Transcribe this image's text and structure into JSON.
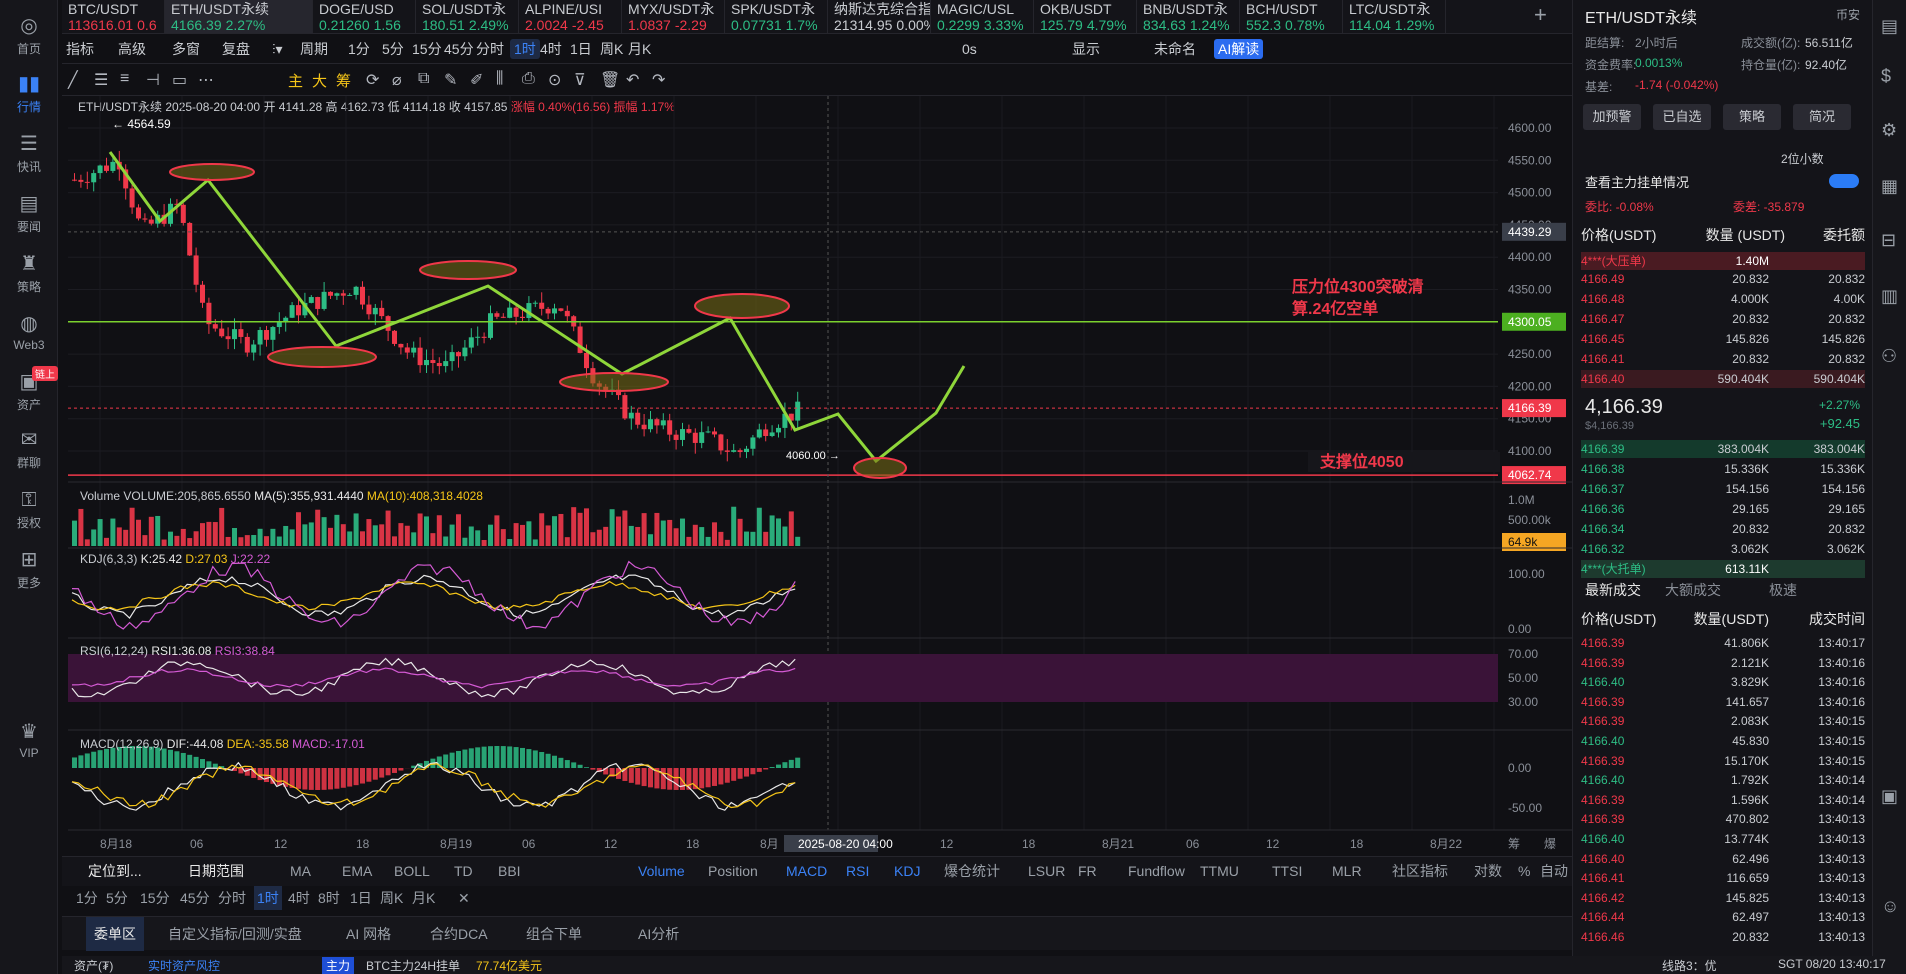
{
  "nav": [
    {
      "label": "首页",
      "icon": "◎"
    },
    {
      "label": "行情",
      "icon": "▮▮"
    },
    {
      "label": "快讯",
      "icon": "☰"
    },
    {
      "label": "要闻",
      "icon": "▤"
    },
    {
      "label": "策略",
      "icon": "♜"
    },
    {
      "label": "Web3",
      "icon": "◍"
    },
    {
      "label": "资产",
      "icon": "▣",
      "badge": "链上"
    },
    {
      "label": "群聊",
      "icon": "✉"
    },
    {
      "label": "授权",
      "icon": "⚿"
    },
    {
      "label": "更多",
      "icon": "⊞"
    },
    {
      "label": "VIP",
      "icon": "♛"
    }
  ],
  "tickers": [
    {
      "name": "BTC/USDT",
      "price": "113616.01",
      "change": "0.6",
      "dir": "down"
    },
    {
      "name": "ETH/USDT永续",
      "price": "4166.39",
      "change": "2.27%",
      "dir": "up",
      "selected": true
    },
    {
      "name": "DOGE/USD",
      "price": "0.21260",
      "change": "1.56",
      "dir": "up"
    },
    {
      "name": "SOL/USDT永",
      "price": "180.51",
      "change": "2.49%",
      "dir": "up"
    },
    {
      "name": "ALPINE/USI",
      "price": "2.0024",
      "change": "-2.45",
      "dir": "down"
    },
    {
      "name": "MYX/USDT永",
      "price": "1.0837",
      "change": "-2.29",
      "dir": "down"
    },
    {
      "name": "SPK/USDT永",
      "price": "0.07731",
      "change": "1.7%",
      "dir": "up"
    },
    {
      "name": "纳斯达克综合指数",
      "price": "21314.95",
      "change": "0.00%",
      "dir": "flat"
    },
    {
      "name": "MAGIC/USL",
      "price": "0.2299",
      "change": "3.33%",
      "dir": "up"
    },
    {
      "name": "OKB/USDT",
      "price": "125.79",
      "change": "4.79%",
      "dir": "up"
    },
    {
      "name": "BNB/USDT永",
      "price": "834.63",
      "change": "1.24%",
      "dir": "up"
    },
    {
      "name": "BCH/USDT",
      "price": "552.3",
      "change": "0.78%",
      "dir": "up"
    },
    {
      "name": "LTC/USDT永",
      "price": "114.04",
      "change": "1.29%",
      "dir": "up"
    }
  ],
  "toolbar": {
    "items": [
      "指标",
      "高级",
      "多窗",
      "复盘",
      "",
      "周期",
      "1分",
      "5分",
      "15分",
      "45分",
      "分时",
      "1时",
      "4时",
      "1日",
      "周K",
      "月K"
    ],
    "active": "1时",
    "right": [
      "0s",
      "显示",
      "未命名",
      "AI解读"
    ]
  },
  "drawtools": {
    "labels": [
      "主",
      "大",
      "筹"
    ]
  },
  "ohlc": {
    "symbol": "ETH/USDT永续",
    "time": "2025-08-20 04:00",
    "open": "开 4141.28",
    "high": "高 4162.73",
    "low": "低 4114.18",
    "close": "收 4157.85",
    "chg": "涨幅 0.40%(16.56)",
    "amp": "振幅 1.17%"
  },
  "price_axis": [
    "4600.00",
    "4550.00",
    "4500.00",
    "4450.00",
    "4400.00",
    "4350.00",
    "4300.00",
    "4250.00",
    "4200.00",
    "4150.00",
    "4100.00"
  ],
  "price_tags": {
    "crosshair": "4439.29",
    "resistance": "4300.05",
    "current": "4166.39",
    "support": "4062.74",
    "vol_tag": "64.9k"
  },
  "annotations": {
    "high": "← 4564.59",
    "low": "4060.00 →",
    "resistance_text1": "压力位4300突破清",
    "resistance_text2": "算.24亿空单",
    "support_text": "支撑位4050"
  },
  "volume": {
    "title": "Volume",
    "vol": "VOLUME:205,865.6550",
    "ma5": "MA(5):355,931.4440",
    "ma10": "MA(10):408,318.4028",
    "axis": [
      "1.0M",
      "500.00k"
    ]
  },
  "kdj": {
    "title": "KDJ(6,3,3)",
    "k": "K:25.42",
    "d": "D:27.03",
    "j": "J:22.22",
    "axis": [
      "100.00",
      "0.00"
    ]
  },
  "rsi": {
    "title": "RSI(6,12,24)",
    "rsi1": "RSI1:36.08",
    "rsi3": "RSI3:38.84",
    "axis": [
      "70.00",
      "50.00",
      "30.00"
    ]
  },
  "macd": {
    "title": "MACD(12,26,9)",
    "dif": "DIF:-44.08",
    "dea": "DEA:-35.58",
    "macd": "MACD:-17.01",
    "axis": [
      "0.00",
      "-50.00"
    ]
  },
  "xaxis": [
    "8月18",
    "06",
    "12",
    "18",
    "8月19",
    "06",
    "12",
    "18",
    "8月",
    "2025-08-20 04:00",
    "12",
    "18",
    "8月21",
    "06",
    "12",
    "18",
    "8月22",
    "筹",
    "爆"
  ],
  "bottom1": {
    "left": [
      "定位到...",
      "日期范围"
    ],
    "items": [
      "MA",
      "EMA",
      "BOLL",
      "TD",
      "BBI",
      "Volume",
      "Position",
      "MACD",
      "RSI",
      "KDJ",
      "爆仓统计",
      "LSUR",
      "FR",
      "Fundflow",
      "TTMU",
      "TTSI",
      "MLR",
      "社区指标",
      "对数",
      "%",
      "自动"
    ],
    "active": [
      "Volume",
      "MACD",
      "RSI",
      "KDJ"
    ]
  },
  "bottom2": {
    "items": [
      "1分",
      "5分",
      "15分",
      "45分",
      "分时",
      "1时",
      "4时",
      "8时",
      "1日",
      "周K",
      "月K",
      "✕"
    ],
    "active": "1时"
  },
  "bottom3": {
    "items": [
      "委单区",
      "自定义指标/回测/实盘",
      "AI 网格",
      "合约DCA",
      "组合下单",
      "AI分析"
    ],
    "active": "委单区"
  },
  "statusbar": {
    "assets": "资产(₮)",
    "risk": "实时资产风控",
    "main": "主力",
    "news": "BTC主力24H挂单",
    "amount": "77.74亿美元",
    "line": "线路3：优",
    "time": "SGT 08/20 13:40:17"
  },
  "right": {
    "title": "ETH/USDT永续",
    "exchange": "币安",
    "info": [
      [
        "距结算:",
        "2小时后",
        "成交额(亿):",
        "56.511亿"
      ],
      [
        "资金费率:",
        "0.0013%",
        "持仓量(亿):",
        "92.40亿"
      ],
      [
        "基差:",
        "-1.74 (-0.042%)",
        "",
        ""
      ]
    ],
    "buttons": [
      "加预警",
      "已自选",
      "策略",
      "简况"
    ],
    "precision": "2位小数",
    "depth_label": "查看主力挂单情况",
    "ratio": "委比: -0.08%",
    "diff": "委差: -35.879",
    "book_headers": [
      "价格(USDT)",
      "数量 (USDT)",
      "委托额"
    ],
    "ask_big": {
      "label": "4***(大压单)",
      "qty": "1.40M"
    },
    "asks": [
      [
        "4166.49",
        "20.832",
        "20.832"
      ],
      [
        "4166.48",
        "4.000K",
        "4.00K"
      ],
      [
        "4166.47",
        "20.832",
        "20.832"
      ],
      [
        "4166.45",
        "145.826",
        "145.826"
      ],
      [
        "4166.41",
        "20.832",
        "20.832"
      ],
      [
        "4166.40",
        "590.404K",
        "590.404K"
      ]
    ],
    "mid": {
      "price": "4,166.39",
      "sub": "$4,166.39",
      "pct": "+2.27%",
      "abs": "+92.45"
    },
    "bids": [
      [
        "4166.39",
        "383.004K",
        "383.004K"
      ],
      [
        "4166.38",
        "15.336K",
        "15.336K"
      ],
      [
        "4166.37",
        "154.156",
        "154.156"
      ],
      [
        "4166.36",
        "29.165",
        "29.165"
      ],
      [
        "4166.34",
        "20.832",
        "20.832"
      ],
      [
        "4166.32",
        "3.062K",
        "3.062K"
      ]
    ],
    "bid_big": {
      "label": "4***(大托单)",
      "qty": "613.11K"
    },
    "trade_tabs": [
      "最新成交",
      "大额成交",
      "极速"
    ],
    "trade_headers": [
      "价格(USDT)",
      "数量(USDT)",
      "成交时间"
    ],
    "trades": [
      [
        "4166.39",
        "41.806K",
        "13:40:17",
        "down"
      ],
      [
        "4166.39",
        "2.121K",
        "13:40:16",
        "down"
      ],
      [
        "4166.40",
        "3.829K",
        "13:40:16",
        "up"
      ],
      [
        "4166.39",
        "141.657",
        "13:40:16",
        "down"
      ],
      [
        "4166.39",
        "2.083K",
        "13:40:15",
        "down"
      ],
      [
        "4166.40",
        "45.830",
        "13:40:15",
        "up"
      ],
      [
        "4166.39",
        "15.170K",
        "13:40:15",
        "down"
      ],
      [
        "4166.40",
        "1.792K",
        "13:40:14",
        "up"
      ],
      [
        "4166.39",
        "1.596K",
        "13:40:14",
        "down"
      ],
      [
        "4166.39",
        "470.802",
        "13:40:13",
        "down"
      ],
      [
        "4166.40",
        "13.774K",
        "13:40:13",
        "up"
      ],
      [
        "4166.40",
        "62.496",
        "13:40:13",
        "down"
      ],
      [
        "4166.41",
        "116.659",
        "13:40:13",
        "down"
      ],
      [
        "4166.42",
        "145.825",
        "13:40:13",
        "down"
      ],
      [
        "4166.44",
        "62.497",
        "13:40:13",
        "down"
      ],
      [
        "4166.46",
        "20.832",
        "13:40:13",
        "down"
      ]
    ]
  },
  "colors": {
    "up": "#2dbd85",
    "down": "#f0384a",
    "accent": "#3b82f6",
    "bg": "#101014"
  }
}
